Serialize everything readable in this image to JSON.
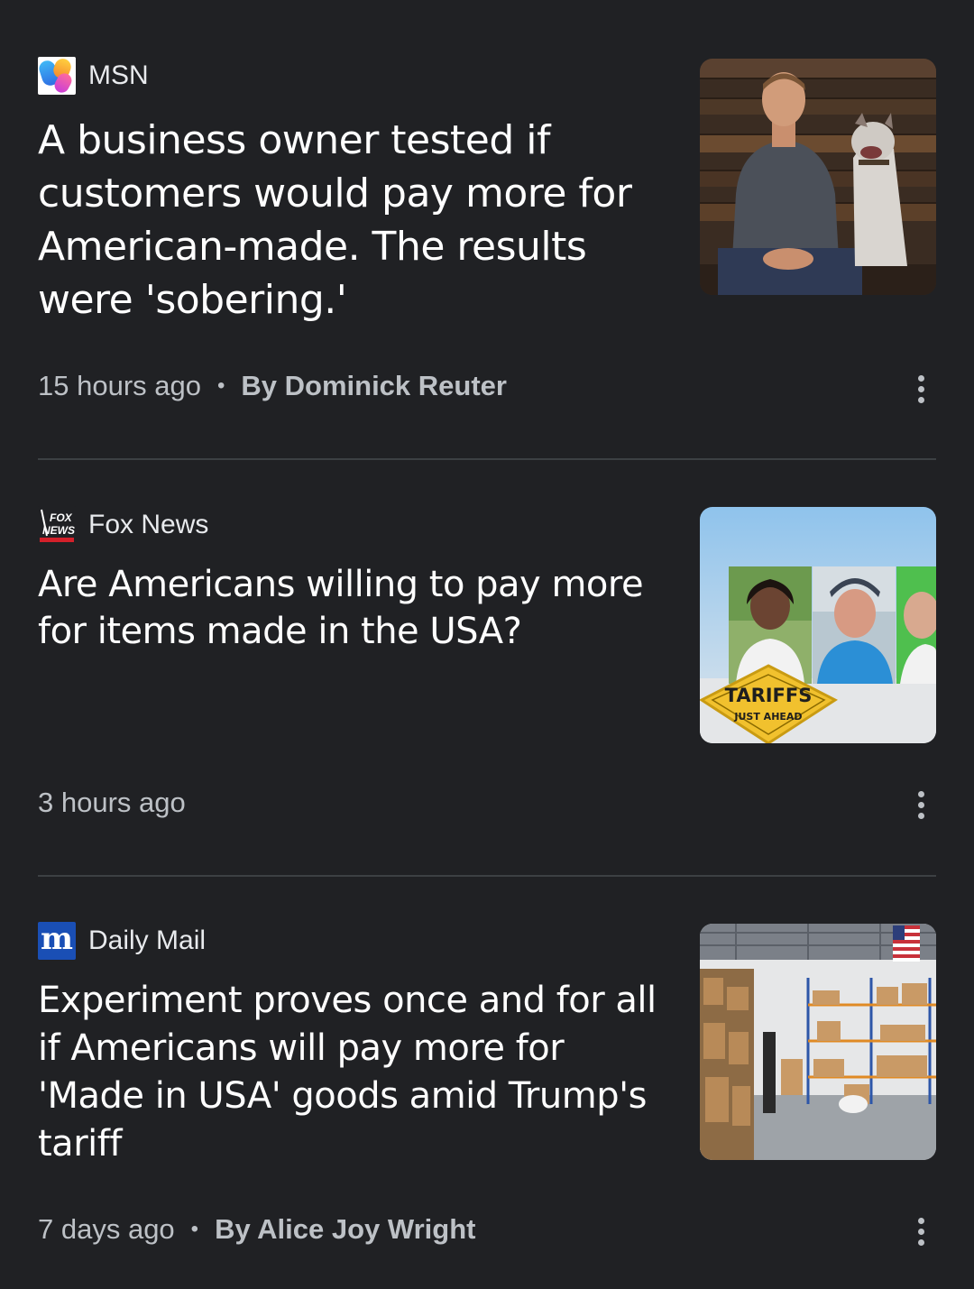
{
  "feed": {
    "articles": [
      {
        "source": "MSN",
        "source_logo_icon": "msn-butterfly-icon",
        "headline": "A business owner tested if customers would pay more for American-made. The results were 'sobering.'",
        "time": "15 hours ago",
        "separator": "•",
        "author": "By Dominick Reuter",
        "thumbnail": "man-with-dog-photo",
        "menu_icon": "more-vert-icon"
      },
      {
        "source": "Fox News",
        "source_logo_icon": "fox-news-icon",
        "headline": "Are Americans willing to pay more for items made in the USA?",
        "time": "3 hours ago",
        "thumbnail": "tariffs-interviews-photo",
        "thumbnail_sign_title": "TARIFFS",
        "thumbnail_sign_subtitle": "JUST AHEAD",
        "menu_icon": "more-vert-icon"
      },
      {
        "source": "Daily Mail",
        "source_logo_icon": "daily-mail-icon",
        "source_logo_glyph": "m",
        "headline": "Experiment proves once and for all if Americans will pay more for 'Made in USA' goods amid Trump's tariff",
        "time": "7 days ago",
        "separator": "•",
        "author": "By Alice Joy Wright",
        "thumbnail": "warehouse-photo",
        "menu_icon": "more-vert-icon"
      }
    ]
  },
  "colors": {
    "background": "#202124",
    "headline": "#ffffff",
    "meta_text": "#bdc1c6",
    "divider": "#3c4043",
    "daily_mail_blue": "#1a4fb5",
    "fox_red": "#d4202a"
  },
  "fox_logo_text": {
    "line1": "FOX",
    "line2": "NEWS"
  }
}
